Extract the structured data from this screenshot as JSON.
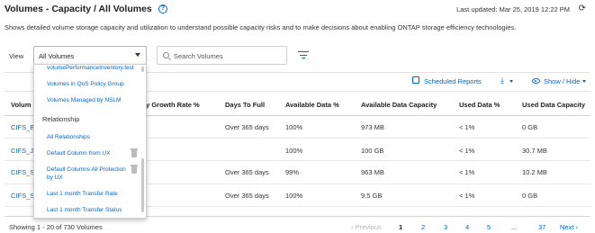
{
  "header": {
    "title": "Volumes - Capacity / All Volumes",
    "help_icon": "question-circle-icon",
    "last_updated": "Last updated: Mar 25, 2019 12:22 PM",
    "refresh_icon": "refresh-icon"
  },
  "subtitle": "Shows detailed volume storage capacity and utilization to understand possible capacity risks and to make decisions about enabling ONTAP storage efficiency technologies.",
  "view": {
    "label": "View",
    "selected": "All Volumes"
  },
  "search": {
    "placeholder": "Search Volumes"
  },
  "toolbar": {
    "scheduled_reports": "Scheduled Reports",
    "show_hide": "Show / Hide"
  },
  "dropdown": {
    "items_top": [
      "volumePerformanceInventory.test",
      "Volumes in QoS Policy Group",
      "Volumes Managed by NSLM"
    ],
    "section": "Relationship",
    "items_bottom": [
      "All Relationships",
      "Default Column from UX",
      "Default Columns All Protection",
      "by UX",
      "Last 1 month Transfer Rate",
      "Last 1 month Transfer Status"
    ]
  },
  "table": {
    "columns": [
      "Volum",
      "ly Growth Rate %",
      "Days To Full",
      "Available Data %",
      "Available Data Capacity",
      "Used Data %",
      "Used Data Capacity"
    ],
    "rows": [
      {
        "name": "CIFS_B",
        "days": "Over 365 days",
        "avail_pct": "100%",
        "avail_cap": "973 MB",
        "used_pct": "< 1%",
        "used_cap": "0 GB"
      },
      {
        "name": "CIFS_Jo",
        "days": "",
        "avail_pct": "100%",
        "avail_cap": "100 GB",
        "used_pct": "< 1%",
        "used_cap": "30.7 MB"
      },
      {
        "name": "CIFS_Sc",
        "days": "Over 365 days",
        "avail_pct": "99%",
        "avail_cap": "963 MB",
        "used_pct": "< 1%",
        "used_cap": "10.2 MB"
      },
      {
        "name": "CIFS_S",
        "days": "Over 365 days",
        "avail_pct": "100%",
        "avail_cap": "9.5 GB",
        "used_pct": "< 1%",
        "used_cap": "0 GB"
      }
    ]
  },
  "footer": {
    "showing": "Showing 1 - 20 of 730 Volumes",
    "previous": "Previous",
    "pages": [
      "1",
      "2",
      "3",
      "4",
      "5"
    ],
    "dots": "...",
    "last_page": "37",
    "next": "Next"
  },
  "colors": {
    "accent": "#0067c5",
    "text": "#333333"
  }
}
